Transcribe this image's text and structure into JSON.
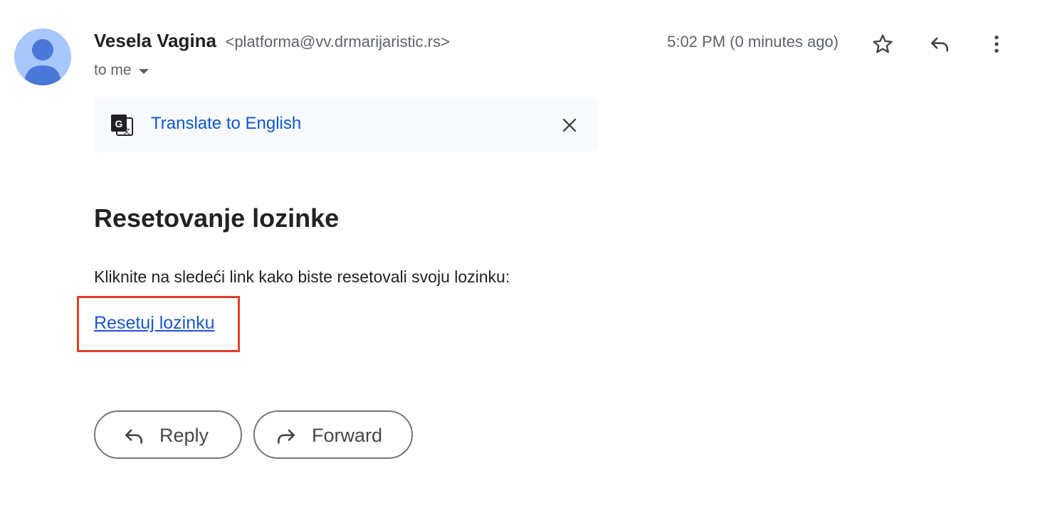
{
  "header": {
    "sender_name": "Vesela Vagina",
    "sender_email": "<platforma@vv.drmarijaristic.rs>",
    "recipient_label": "to me",
    "timestamp": "5:02 PM (0 minutes ago)",
    "icons": [
      "star-icon",
      "reply-icon",
      "more-vert-icon"
    ]
  },
  "translate_banner": {
    "link_label": "Translate to English",
    "icons": [
      "translate-icon",
      "close-icon"
    ]
  },
  "email_body": {
    "heading": "Resetovanje lozinke",
    "instruction": "Kliknite na sledeći link kako biste resetovali svoju lozinku:",
    "link_label": "Resetuj lozinku"
  },
  "actions": {
    "reply_label": "Reply",
    "forward_label": "Forward"
  },
  "colors": {
    "avatar_bg": "#a8c7fa",
    "avatar_fg": "#4a78d8",
    "link": "#1a56c9",
    "translate_link": "#0b57d0",
    "highlight_border": "#e0402a"
  }
}
